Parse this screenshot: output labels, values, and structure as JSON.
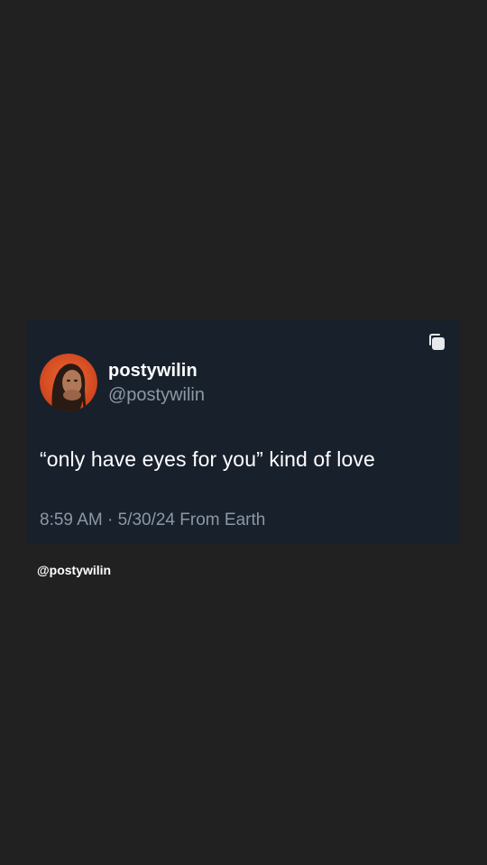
{
  "post": {
    "display_name": "postywilin",
    "handle": "@postywilin",
    "text": "“only have eyes for you” kind of love",
    "time": "8:59 AM",
    "separator": "·",
    "date": "5/30/24",
    "location": "From Earth"
  },
  "watermark": "@postywilin",
  "icons": {
    "copy": "copy-icon",
    "avatar": "avatar"
  },
  "colors": {
    "background": "#212121",
    "card": "#18202c",
    "primary_text": "#ffffff",
    "secondary_text": "#8b98a5",
    "avatar_accent": "#e8572a"
  }
}
